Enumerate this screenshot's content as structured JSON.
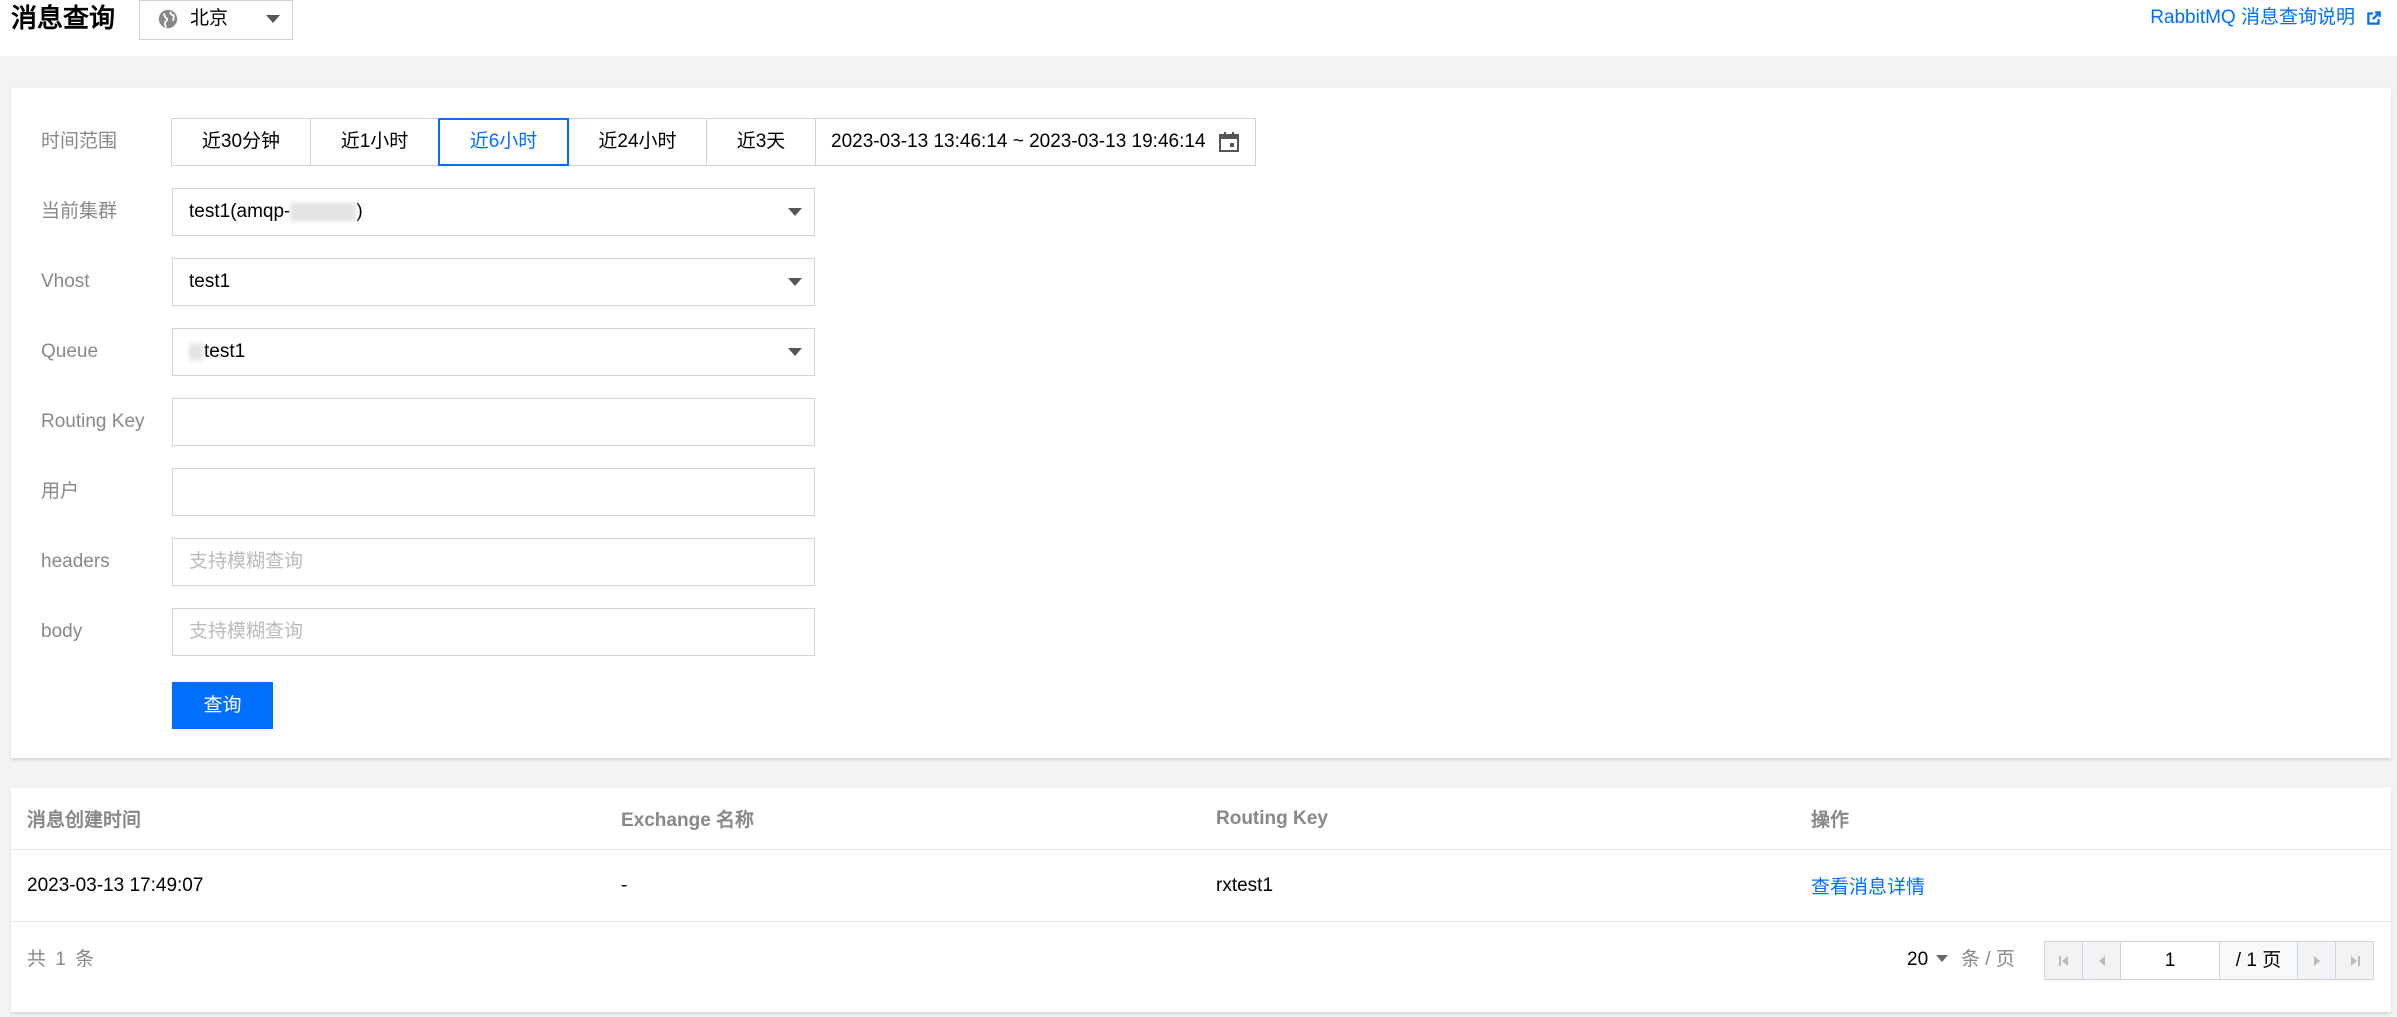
{
  "header": {
    "title": "消息查询",
    "region": "北京",
    "doc_link": "RabbitMQ 消息查询说明"
  },
  "form": {
    "time_range": {
      "label": "时间范围",
      "options": [
        "近30分钟",
        "近1小时",
        "近6小时",
        "近24小时",
        "近3天"
      ],
      "selected": "近6小时",
      "range_text": "2023-03-13 13:46:14 ~ 2023-03-13 19:46:14"
    },
    "cluster": {
      "label": "当前集群",
      "value_prefix": "test1(amqp-",
      "value_suffix": ")"
    },
    "vhost": {
      "label": "Vhost",
      "value": "test1"
    },
    "queue": {
      "label": "Queue",
      "value": "test1"
    },
    "routing_key": {
      "label": "Routing Key",
      "value": ""
    },
    "user": {
      "label": "用户",
      "value": ""
    },
    "headers": {
      "label": "headers",
      "placeholder": "支持模糊查询"
    },
    "body": {
      "label": "body",
      "placeholder": "支持模糊查询"
    },
    "query_button": "查询"
  },
  "table": {
    "columns": [
      "消息创建时间",
      "Exchange 名称",
      "Routing Key",
      "操作"
    ],
    "rows": [
      {
        "created": "2023-03-13 17:49:07",
        "exchange": "-",
        "routing_key": "rxtest1",
        "action": "查看消息详情"
      }
    ]
  },
  "pagination": {
    "total": "共 1 条",
    "page_size": "20",
    "per_page": "条 / 页",
    "current_page": "1",
    "total_pages": "/ 1 页"
  },
  "colors": {
    "accent": "#006eff",
    "label": "#888888",
    "border": "#cfd5de",
    "background": "#f2f3f5"
  }
}
